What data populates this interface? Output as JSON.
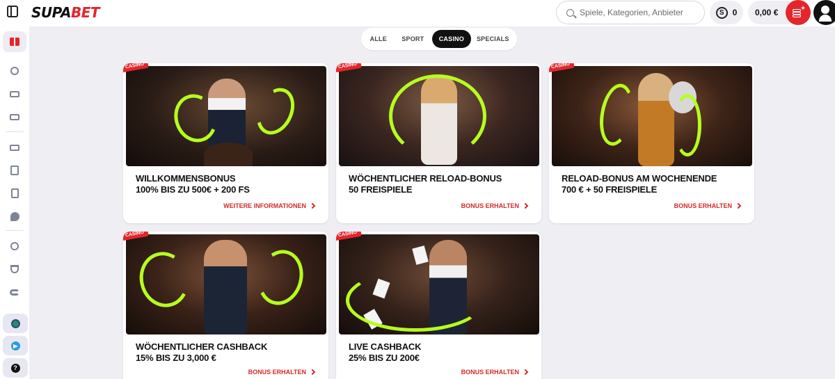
{
  "brand": {
    "logo_part1": "SUPA",
    "logo_part2": "BET"
  },
  "header": {
    "search_placeholder": "Spiele, Kategorien, Anbieter",
    "points_value": "0",
    "points_icon_glyph": "S",
    "balance": "0,00 €"
  },
  "sidebar": {
    "icons": [
      "gift-icon",
      "soccer-icon",
      "live-icon",
      "esports-icon",
      "casino-icon",
      "lottery-icon",
      "cards-icon",
      "slots-icon",
      "medal-icon",
      "trophy-icon",
      "promo-icon"
    ],
    "help_glyph": "?"
  },
  "filters": {
    "tabs": [
      {
        "label": "ALLE",
        "active": false
      },
      {
        "label": "SPORT",
        "active": false
      },
      {
        "label": "CASINO",
        "active": true
      },
      {
        "label": "SPECIALS",
        "active": false
      }
    ]
  },
  "cards": [
    {
      "badge": "CASINO",
      "title_line1": "WILLKOMMENSBONUS",
      "title_line2": "100% BIS ZU 500€ + 200 FS",
      "link": "WEITERE INFORMATIONEN"
    },
    {
      "badge": "CASINO",
      "title_line1": "WÖCHENTLICHER RELOAD-BONUS",
      "title_line2": "50 FREISPIELE",
      "link": "BONUS ERHALTEN"
    },
    {
      "badge": "CASINO",
      "title_line1": "RELOAD-BONUS AM WOCHENENDE",
      "title_line2": "700 € + 50 FREISPIELE",
      "link": "BONUS ERHALTEN"
    },
    {
      "badge": "CASINO",
      "title_line1": "WÖCHENTLICHER CASHBACK",
      "title_line2": "15% BIS ZU 3,000 €",
      "link": "BONUS ERHALTEN"
    },
    {
      "badge": "CASINO",
      "title_line1": "LIVE CASHBACK",
      "title_line2": "25% BIS ZU 200€",
      "link": "BONUS ERHALTEN"
    }
  ],
  "colors": {
    "accent": "#e3262b",
    "lime": "#b6ff1f",
    "page_bg": "#eeeef3"
  }
}
